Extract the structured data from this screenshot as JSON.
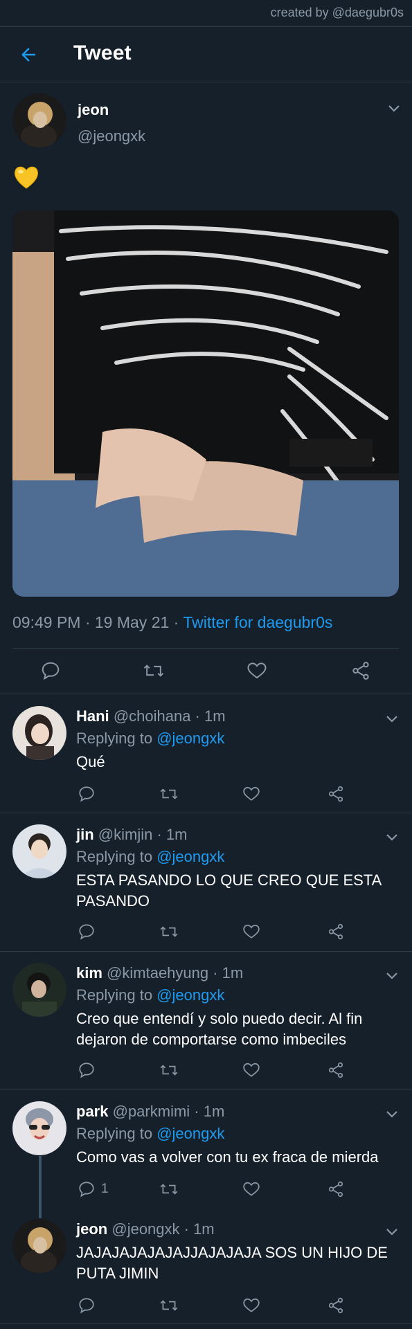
{
  "watermark": "created by @daegubr0s",
  "header": {
    "title": "Tweet"
  },
  "tweet": {
    "name": "jeon",
    "handle": "@jeongxk",
    "content_emoji": "💛",
    "time": "09:49 PM · 19 May 21 · ",
    "source": "Twitter for daegubr0s"
  },
  "replies": [
    {
      "name": "Hani",
      "handle": "@choihana · 1m",
      "replying_label": "Replying to ",
      "replying_to": "@jeongxk",
      "text": "Qué",
      "reply_count": ""
    },
    {
      "name": "jin",
      "handle": "@kimjin · 1m",
      "replying_label": "Replying to ",
      "replying_to": "@jeongxk",
      "text": "ESTA PASANDO LO QUE CREO QUE ESTA PASANDO",
      "reply_count": ""
    },
    {
      "name": "kim",
      "handle": "@kimtaehyung · 1m",
      "replying_label": "Replying to ",
      "replying_to": "@jeongxk",
      "text": "Creo que entendí y solo puedo decir. Al fin dejaron de comportarse como imbeciles",
      "reply_count": ""
    },
    {
      "name": "park",
      "handle": "@parkmimi · 1m",
      "replying_label": "Replying to ",
      "replying_to": "@jeongxk",
      "text": "Como vas a volver con tu ex fraca de mierda",
      "reply_count": "1"
    },
    {
      "name": "jeon",
      "handle": "@jeongxk · 1m",
      "text": "JAJAJAJAJAJAJJAJAJAJA SOS UN HIJO DE PUTA JIMIN",
      "reply_count": ""
    }
  ],
  "icons": {
    "back": "arrow-left-icon",
    "more": "chevron-down-icon",
    "reply": "comment-icon",
    "retweet": "retweet-icon",
    "like": "heart-icon",
    "share": "share-icon"
  },
  "colors": {
    "background": "#15202b",
    "accent": "#1d9bf0",
    "muted": "#8b98a5",
    "divider": "#2b3a49"
  }
}
